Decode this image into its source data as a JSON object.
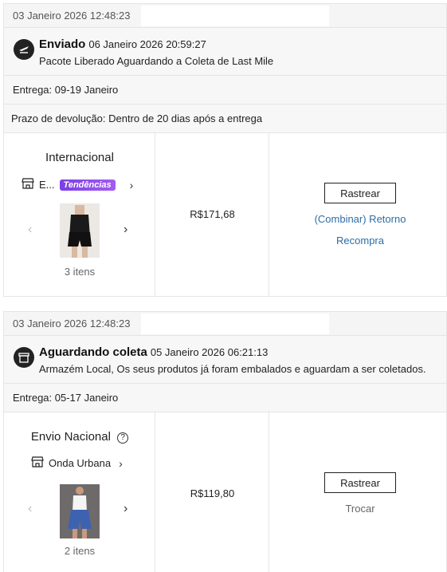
{
  "orders": [
    {
      "date": "03 Janeiro 2026 12:48:23",
      "status_title": "Enviado",
      "status_time": "06 Janeiro 2026 20:59:27",
      "status_desc": "Pacote Liberado Aguardando a Coleta de Last Mile",
      "status_icon": "plane-icon",
      "delivery": "Entrega: 09-19 Janeiro",
      "returns": "Prazo de devolução: Dentro de 20 dias após a entrega",
      "shipping_type": "Internacional",
      "store_name": "E...",
      "store_badge": "Tendências",
      "items_count": "3 itens",
      "price": "R$171,68",
      "track_label": "Rastrear",
      "actions": [
        "(Combinar) Retorno",
        "Recompra"
      ]
    },
    {
      "date": "03 Janeiro 2026 12:48:23",
      "status_title": "Aguardando coleta",
      "status_time": "05 Janeiro 2026 06:21:13",
      "status_desc": "Armazém Local, Os seus produtos já foram embalados e aguardam a ser coletados.",
      "status_icon": "box-icon",
      "delivery": "Entrega: 05-17 Janeiro",
      "shipping_type": "Envio Nacional",
      "store_name": "Onda Urbana",
      "items_count": "2 itens",
      "price": "R$119,80",
      "track_label": "Rastrear",
      "actions": [
        "Trocar"
      ]
    }
  ]
}
